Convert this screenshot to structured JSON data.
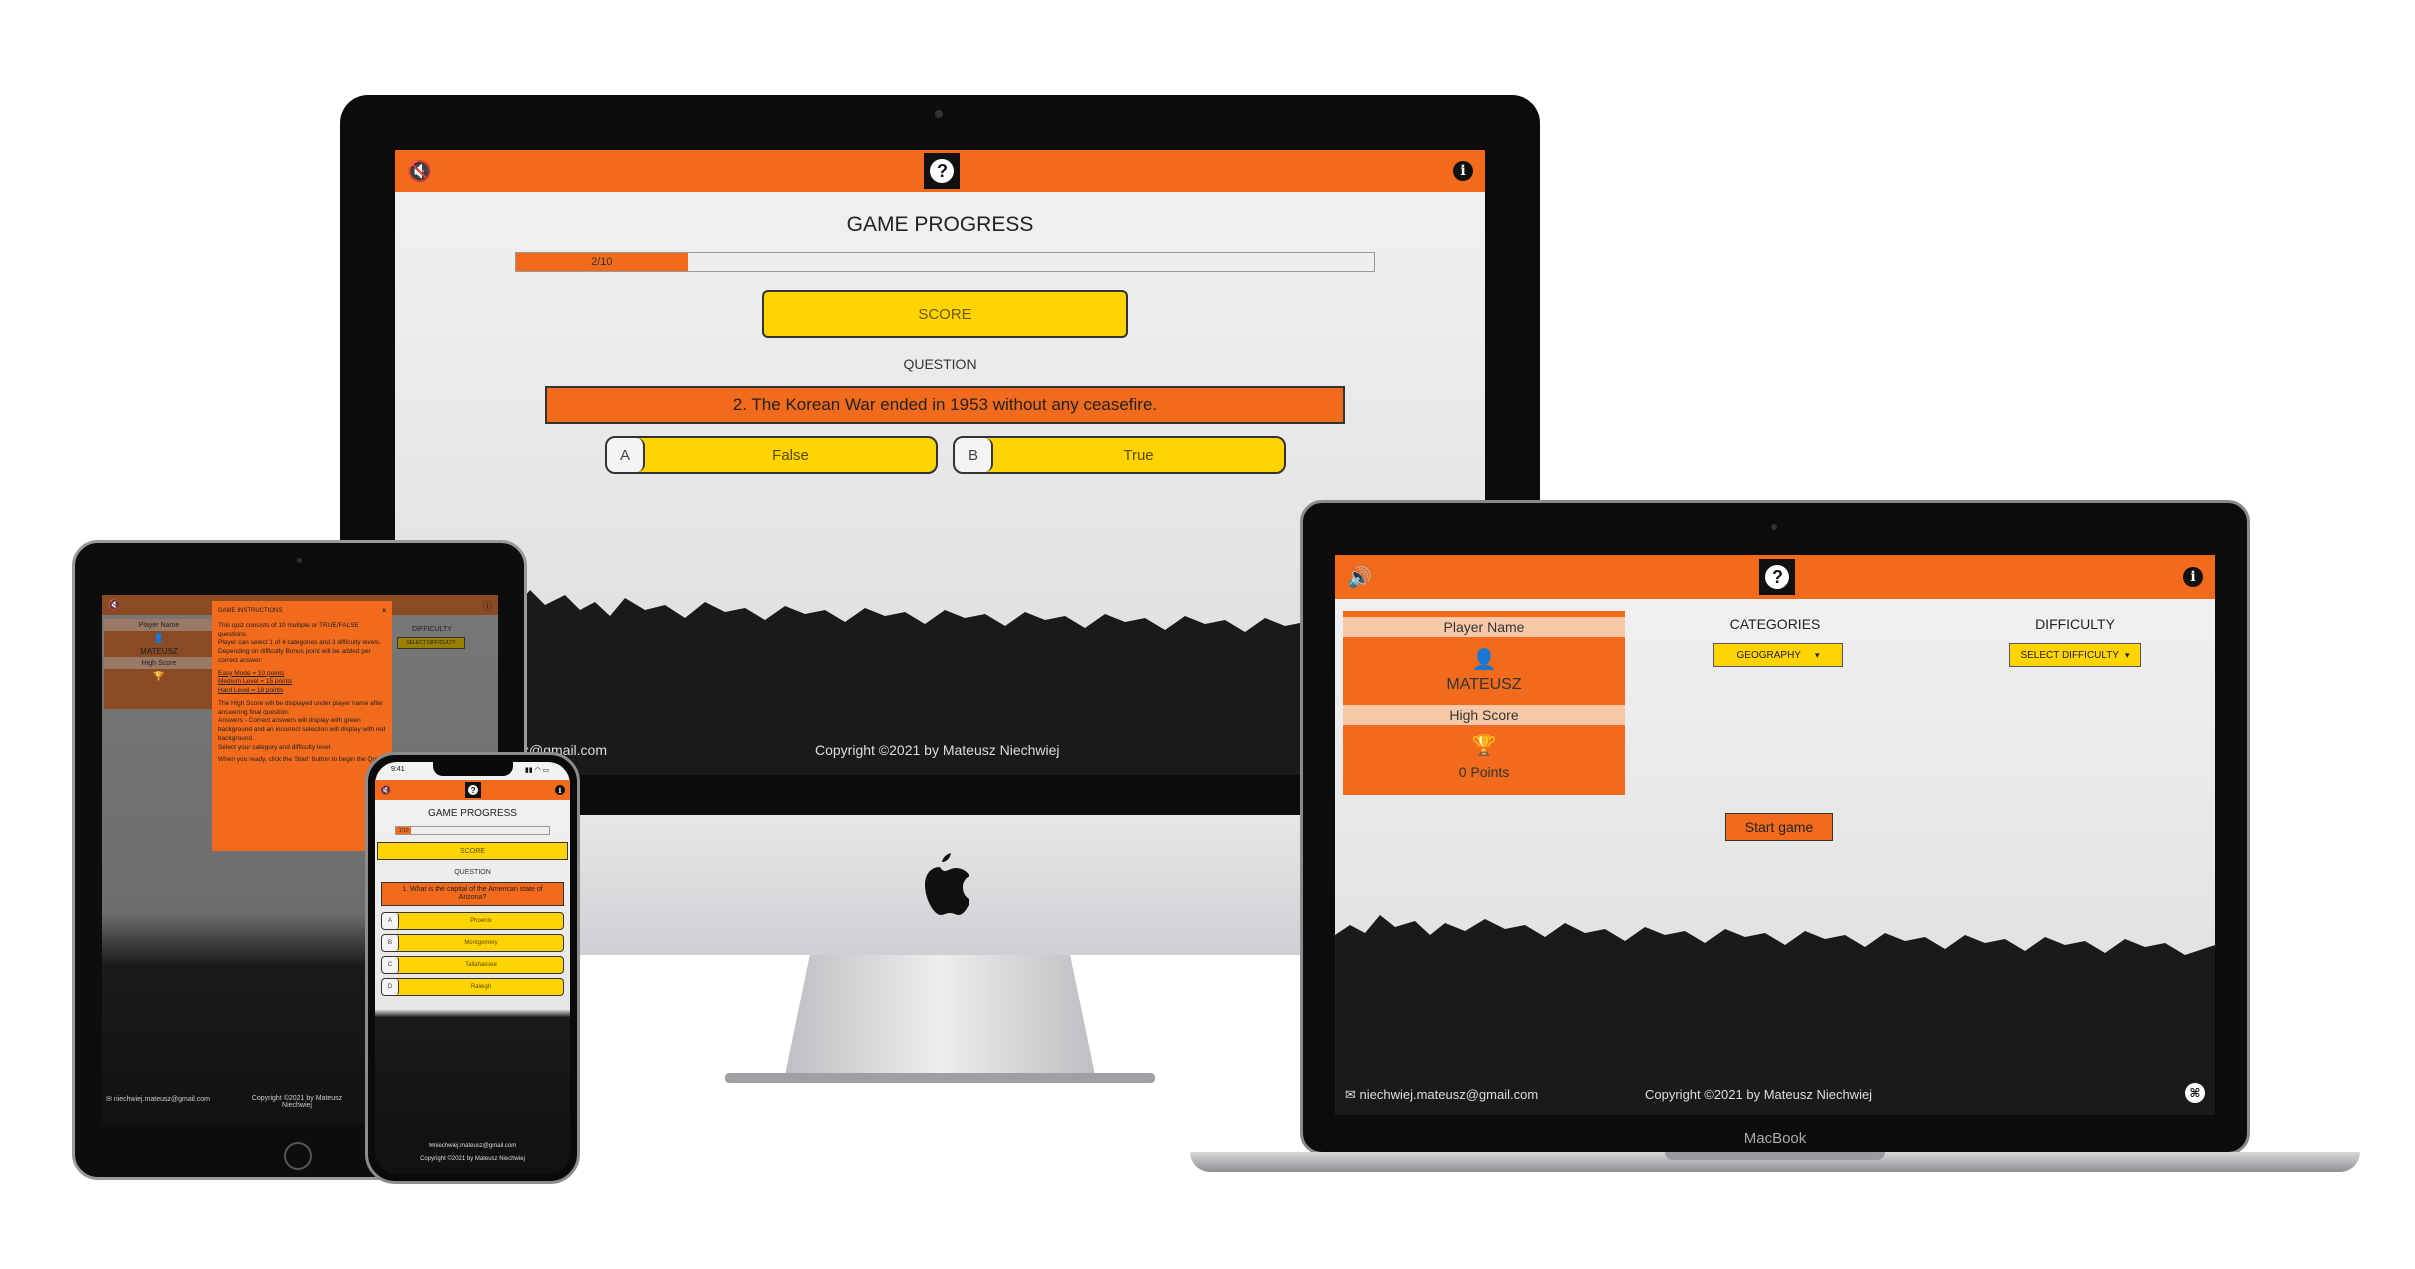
{
  "desktop": {
    "heading": "GAME PROGRESS",
    "progress_label": "2/10",
    "progress_fraction": 0.2,
    "score_label": "SCORE",
    "question_label": "QUESTION",
    "question_text": "2. The Korean War ended in 1953 without any ceasefire.",
    "answers": [
      {
        "letter": "A",
        "text": "False"
      },
      {
        "letter": "B",
        "text": "True"
      }
    ],
    "email_partial": "sz@gmail.com",
    "copyright": "Copyright ©2021 by Mateusz Niechwiej"
  },
  "laptop": {
    "player_name_label": "Player Name",
    "player_name": "MATEUSZ",
    "high_score_label": "High Score",
    "high_score_value": "0 Points",
    "categories_label": "CATEGORIES",
    "category_selected": "GEOGRAPHY",
    "difficulty_label": "DIFFICULTY",
    "difficulty_selected": "SELECT DIFFICULTY",
    "start_button": "Start game",
    "email": "niechwiej.mateusz@gmail.com",
    "copyright": "Copyright ©2021 by Mateusz Niechwiej",
    "brand": "MacBook"
  },
  "tablet": {
    "player_name_label": "Player Name",
    "player_name": "MATEUSZ",
    "high_score_label": "High Score",
    "difficulty_label": "DIFFICULTY",
    "difficulty_selected": "SELECT DIFFICULTY",
    "modal_title": "GAME INSTRUCTIONS",
    "modal_close": "x",
    "modal_p1": "This quiz consists of 10 multiple or TRUE/FALSE questions.",
    "modal_p2": "Player can select 1 of 4 categories and 3 difficulty levels.",
    "modal_p3": "Depending on difficulty Bonus point will be added per correct answer:",
    "modal_easy": "Easy Mode = 10 points",
    "modal_medium": "Medium Level = 15 points",
    "modal_hard": "Hard Level = 18 points",
    "modal_p4": "The High Score will be displayed under player name after answering final question.",
    "modal_p5": "Answers - Correct answers will display with green background and an incorrect selection will display with red background.",
    "modal_p6": "Select your category and difficulty level.",
    "modal_p7": "When you ready, click the 'Start' button to begin the Quiz.",
    "email": "niechwiej.mateusz@gmail.com",
    "copyright": "Copyright ©2021 by Mateusz Niechwiej"
  },
  "phone": {
    "time": "9:41",
    "heading": "GAME PROGRESS",
    "progress_label": "1/10",
    "progress_fraction": 0.1,
    "score_label": "SCORE",
    "question_label": "QUESTION",
    "question_text": "1. What is the capital of the American state of Arizona?",
    "answers": [
      {
        "letter": "A",
        "text": "Phoenix"
      },
      {
        "letter": "B",
        "text": "Montgomery"
      },
      {
        "letter": "C",
        "text": "Tallahassee"
      },
      {
        "letter": "D",
        "text": "Raleigh"
      }
    ],
    "email": "niechwiej.mateusz@gmail.com",
    "copyright": "Copyright ©2021 by Mateusz Niechwiej"
  },
  "colors": {
    "accent": "#f26b1d",
    "highlight": "#ffd400",
    "dark": "#111111"
  }
}
